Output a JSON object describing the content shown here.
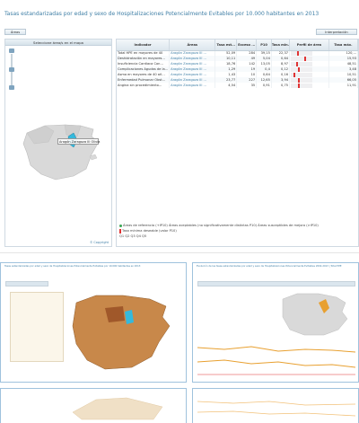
{
  "title": "Tasas estandarizadas por edad y sexo de Hospitalizaciones Potencialmente Evitables por 10.000 habitantes en 2013",
  "buttons": {
    "areas": "Áreas",
    "interpretacion": "Interpretación"
  },
  "left_panel": {
    "header": "Seleccione área/s en el mapa",
    "selected_area": "Aragón Zaragoza III Olivia",
    "copyright": "© Copyright"
  },
  "table": {
    "headers": [
      "Indicador",
      "Áreas",
      "Tasa est...",
      "Exceso ...",
      "P10",
      "Tasa min.",
      "Perfil de área",
      "Tasa máx."
    ],
    "rows": [
      {
        "indicador": "Total HPE en mayores de 40",
        "area": "Aragón Zaragoza III ...",
        "tasa": "52,09",
        "exceso": "284",
        "p10": "39,15",
        "min": "22,37",
        "max": "120,...",
        "mark": 0.28
      },
      {
        "indicador": "Deshidratación en mayores...",
        "area": "Aragón Zaragoza III ...",
        "tasa": "10,11",
        "exceso": "49",
        "p10": "5,04",
        "min": "0,64",
        "max": "15,93",
        "mark": 0.62
      },
      {
        "indicador": "Insuficiencia Cardiaca Con...",
        "area": "Aragón Zaragoza III ...",
        "tasa": "18,76",
        "exceso": "142",
        "p10": "13,05",
        "min": "8,97",
        "max": "48,51",
        "mark": 0.26
      },
      {
        "indicador": "Complicaciones Agudas de la...",
        "area": "Aragón Zaragoza III ...",
        "tasa": "1,29",
        "exceso": "19",
        "p10": "0,4",
        "min": "0,12",
        "max": "3,48",
        "mark": 0.35
      },
      {
        "indicador": "Asma en mayores de 40 añ...",
        "area": "Aragón Zaragoza III ...",
        "tasa": "1,43",
        "exceso": "10",
        "p10": "0,64",
        "min": "0,16",
        "max": "10,51",
        "mark": 0.12
      },
      {
        "indicador": "Enfermedad Pulmonar Obst...",
        "area": "Aragón Zaragoza III ...",
        "tasa": "23,77",
        "exceso": "227",
        "p10": "12,65",
        "min": "3,94",
        "max": "66,05",
        "mark": 0.32
      },
      {
        "indicador": "Angina sin procedimiento...",
        "area": "Aragón Zaragoza III ...",
        "tasa": "4,54",
        "exceso": "35",
        "p10": "0,91",
        "min": "0,75",
        "max": "11,91",
        "mark": 0.34
      }
    ]
  },
  "legend": {
    "line1": "Áreas de referencia (+IP10)  Áreas aceptables (no significativamente distintas P10)  Áreas susceptibles de mejora (>IP10)",
    "line2": "Tasa mínima deseable (valor P10)",
    "line3": "Q1  Q2  Q3  Q4  Q5",
    "colors": {
      "ref": "#3aa655",
      "ok": "#e8b23a",
      "improve": "#d63a3a"
    }
  },
  "thumbs": {
    "t1_title": "Tasas estandarizadas por edad y sexo de Hospitalizaciones Potencialmente Evitables por 10.000 habitantes en 2013",
    "t2_title": "Evolución de las tasas estandarizadas por edad y sexo de Hospitalizaciones Potencialmente Evitables 2002-2013 | Total HPE"
  }
}
